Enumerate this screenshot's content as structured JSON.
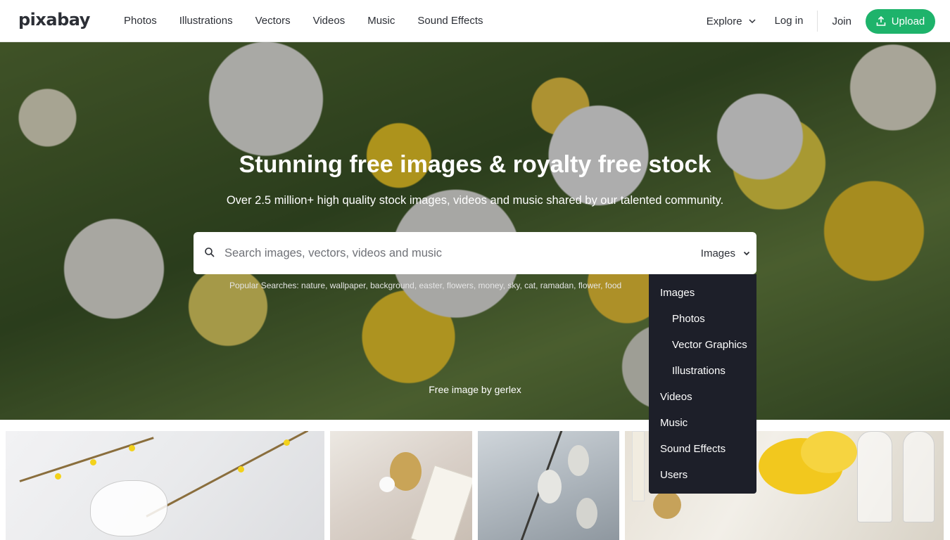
{
  "header": {
    "logo": "pixabay",
    "nav": [
      "Photos",
      "Illustrations",
      "Vectors",
      "Videos",
      "Music",
      "Sound Effects"
    ],
    "explore_label": "Explore",
    "login_label": "Log in",
    "join_label": "Join",
    "upload_label": "Upload"
  },
  "hero": {
    "title": "Stunning free images & royalty free stock",
    "subtitle": "Over 2.5 million+ high quality stock images, videos and music shared by our talented community.",
    "search_placeholder": "Search images, vectors, videos and music",
    "search_type": "Images",
    "popular_searches": "Popular Searches: nature, wallpaper, background, easter, flowers, money, sky, cat, ramadan, flower, food",
    "credit": "Free image by gerlex"
  },
  "dropdown": {
    "items": [
      {
        "label": "Images",
        "sub": false
      },
      {
        "label": "Photos",
        "sub": true
      },
      {
        "label": "Vector Graphics",
        "sub": true
      },
      {
        "label": "Illustrations",
        "sub": true
      },
      {
        "label": "Videos",
        "sub": false
      },
      {
        "label": "Music",
        "sub": false
      },
      {
        "label": "Sound Effects",
        "sub": false
      },
      {
        "label": "Users",
        "sub": false
      }
    ]
  },
  "colors": {
    "upload_green": "#1eb36b",
    "dropdown_bg": "#1d1f29"
  }
}
